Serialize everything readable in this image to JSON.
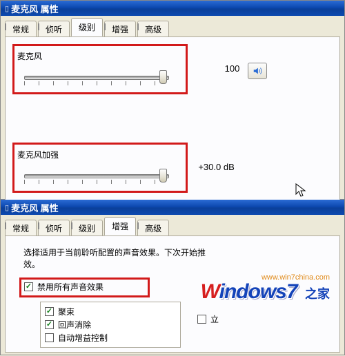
{
  "top_window": {
    "title": "麦克风 属性",
    "tabs": [
      "常规",
      "侦听",
      "级别",
      "增强",
      "高级"
    ],
    "active_tab_index": 2,
    "mic": {
      "label": "麦克风",
      "value": "100",
      "slider_percent": 100
    },
    "boost": {
      "label": "麦克风加强",
      "value": "+30.0 dB",
      "slider_percent": 100
    },
    "speaker_icon": "speaker-icon"
  },
  "bottom_window": {
    "title": "麦克风 属性",
    "tabs": [
      "常规",
      "侦听",
      "级别",
      "增强",
      "高级"
    ],
    "active_tab_index": 3,
    "description": "选择适用于当前聆听配置的声音效果。下次开始推\n效。",
    "disable_all": {
      "label": "禁用所有声音效果",
      "checked": true
    },
    "right_opt": {
      "label": "立",
      "checked": false
    },
    "options": [
      {
        "label": "聚束",
        "checked": true
      },
      {
        "label": "回声消除",
        "checked": true
      },
      {
        "label": "自动增益控制",
        "checked": false
      }
    ]
  },
  "watermark": {
    "url": "www.win7china.com",
    "brand_w": "W",
    "brand_rest": "indows7",
    "tag": "之家"
  }
}
